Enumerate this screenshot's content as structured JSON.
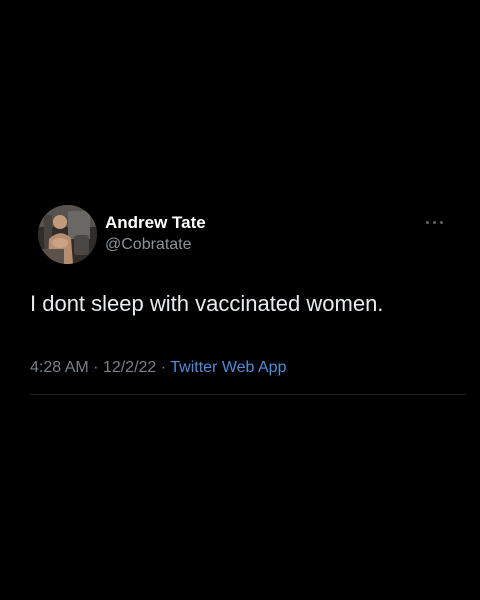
{
  "tweet": {
    "author_name": "Andrew Tate",
    "author_handle": "@Cobratate",
    "text": "I dont sleep with vaccinated women.",
    "time": "4:28 AM",
    "date": "12/2/22",
    "source": "Twitter Web App",
    "separator": "·"
  },
  "colors": {
    "background": "#000000",
    "name": "#ffffff",
    "muted": "#7a8087",
    "link": "#4b8ddb"
  },
  "icons": {
    "more": "more-horizontal-icon"
  }
}
